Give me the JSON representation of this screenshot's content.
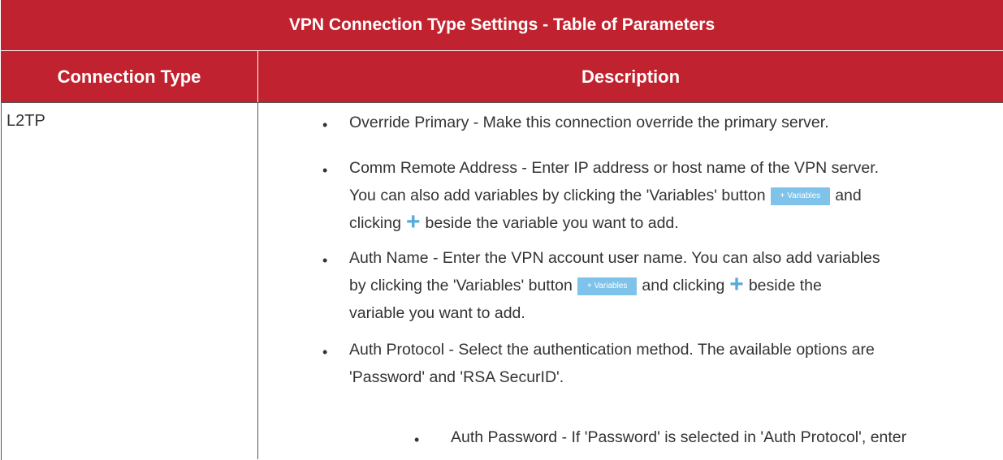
{
  "table": {
    "title": "VPN Connection Type Settings - Table of Parameters",
    "col_type_header": "Connection Type",
    "col_desc_header": "Description",
    "type_value": "L2TP"
  },
  "items": {
    "override": "Override Primary - Make this connection override the primary server.",
    "comm_line1": "Comm Remote Address - Enter IP address or host name of the VPN server.",
    "comm_line2_a": "You can also add variables by clicking the 'Variables' button",
    "comm_line2_b": "and",
    "comm_line3_a": "clicking",
    "comm_line3_b": "beside the variable you want to add.",
    "auth_line1": "Auth Name - Enter the VPN account user name. You can also add variables",
    "auth_line2_a": "by clicking the 'Variables' button",
    "auth_line2_b": "and clicking",
    "auth_line2_c": "beside the",
    "auth_line3": "variable you want to add.",
    "proto_line1": "Auth Protocol - Select the authentication method. The available options are",
    "proto_line2": "'Password' and 'RSA SecurID'.",
    "pass_line1": "Auth Password - If 'Password' is selected in 'Auth Protocol', enter"
  },
  "widgets": {
    "variables_button_label": "+ Variables",
    "plus_icon": "+",
    "bullet": "•",
    "accent_color": "#c0232f",
    "button_color": "#7fc3ea"
  }
}
